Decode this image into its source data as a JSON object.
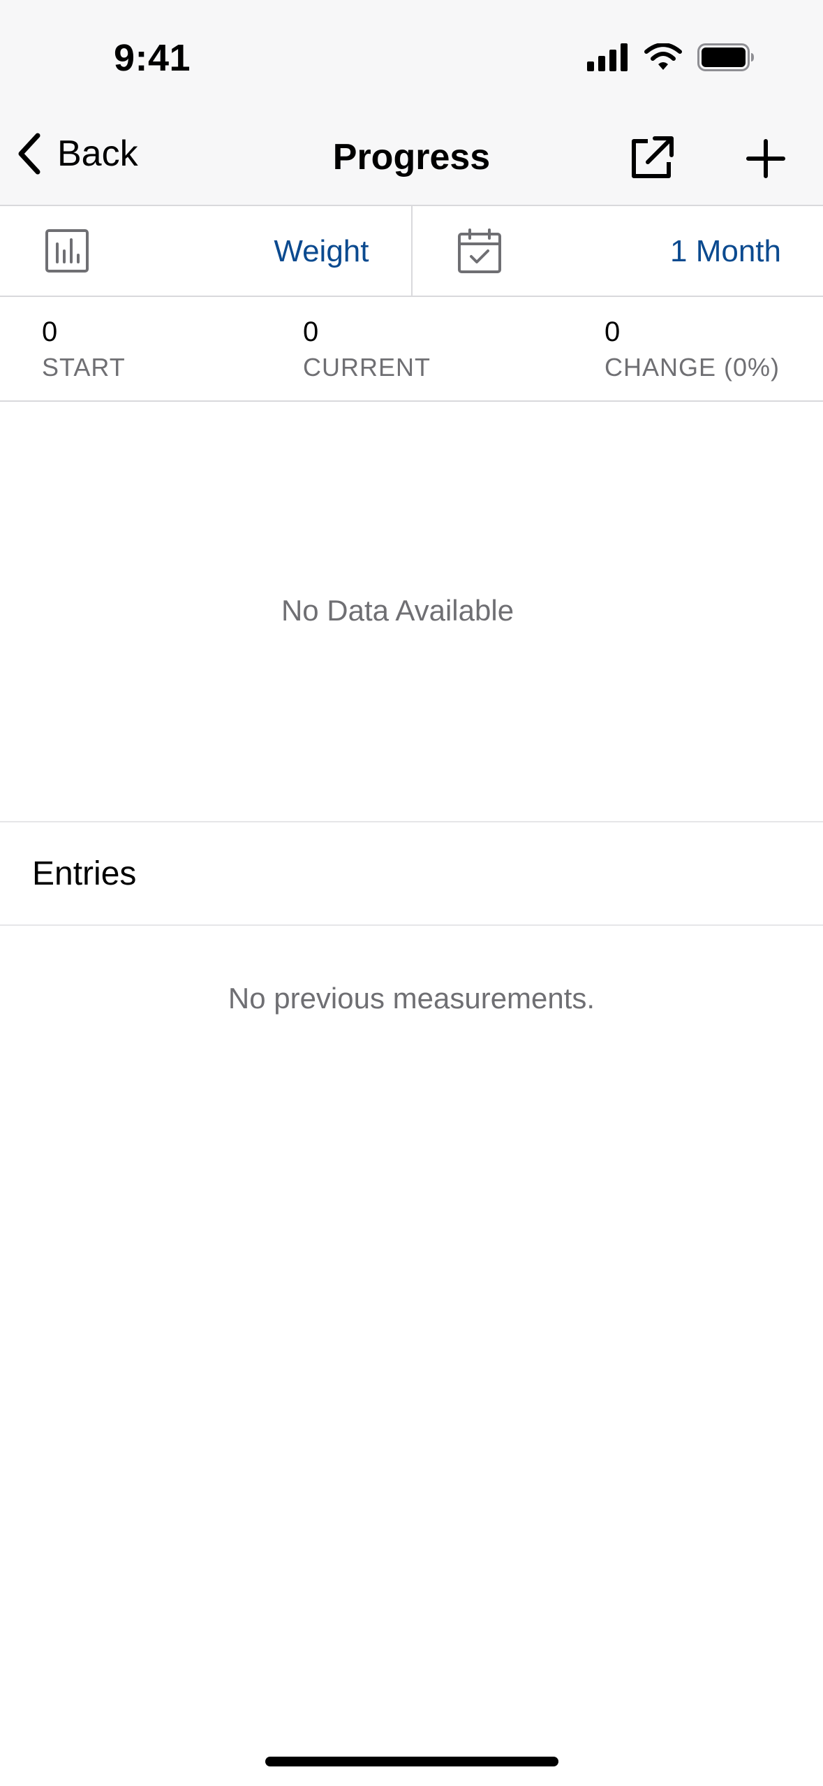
{
  "status_bar": {
    "time": "9:41"
  },
  "nav": {
    "back_label": "Back",
    "title": "Progress"
  },
  "selectors": {
    "metric": {
      "value": "Weight"
    },
    "range": {
      "value": "1 Month"
    }
  },
  "stats": [
    {
      "value": "0",
      "label": "START"
    },
    {
      "value": "0",
      "label": "CURRENT"
    },
    {
      "value": "0",
      "label": "CHANGE (0%)"
    }
  ],
  "chart": {
    "empty_message": "No Data Available"
  },
  "entries": {
    "title": "Entries",
    "empty_message": "No previous measurements."
  },
  "colors": {
    "accent": "#0b4a8f",
    "secondary_text": "#6f6f73",
    "divider": "#d9d9dc",
    "topbar_bg": "#f7f7f8"
  },
  "icons": {
    "back": "chevron-left-icon",
    "export": "share-external-icon",
    "add": "plus-icon",
    "metric": "bar-chart-icon",
    "range": "calendar-check-icon"
  }
}
